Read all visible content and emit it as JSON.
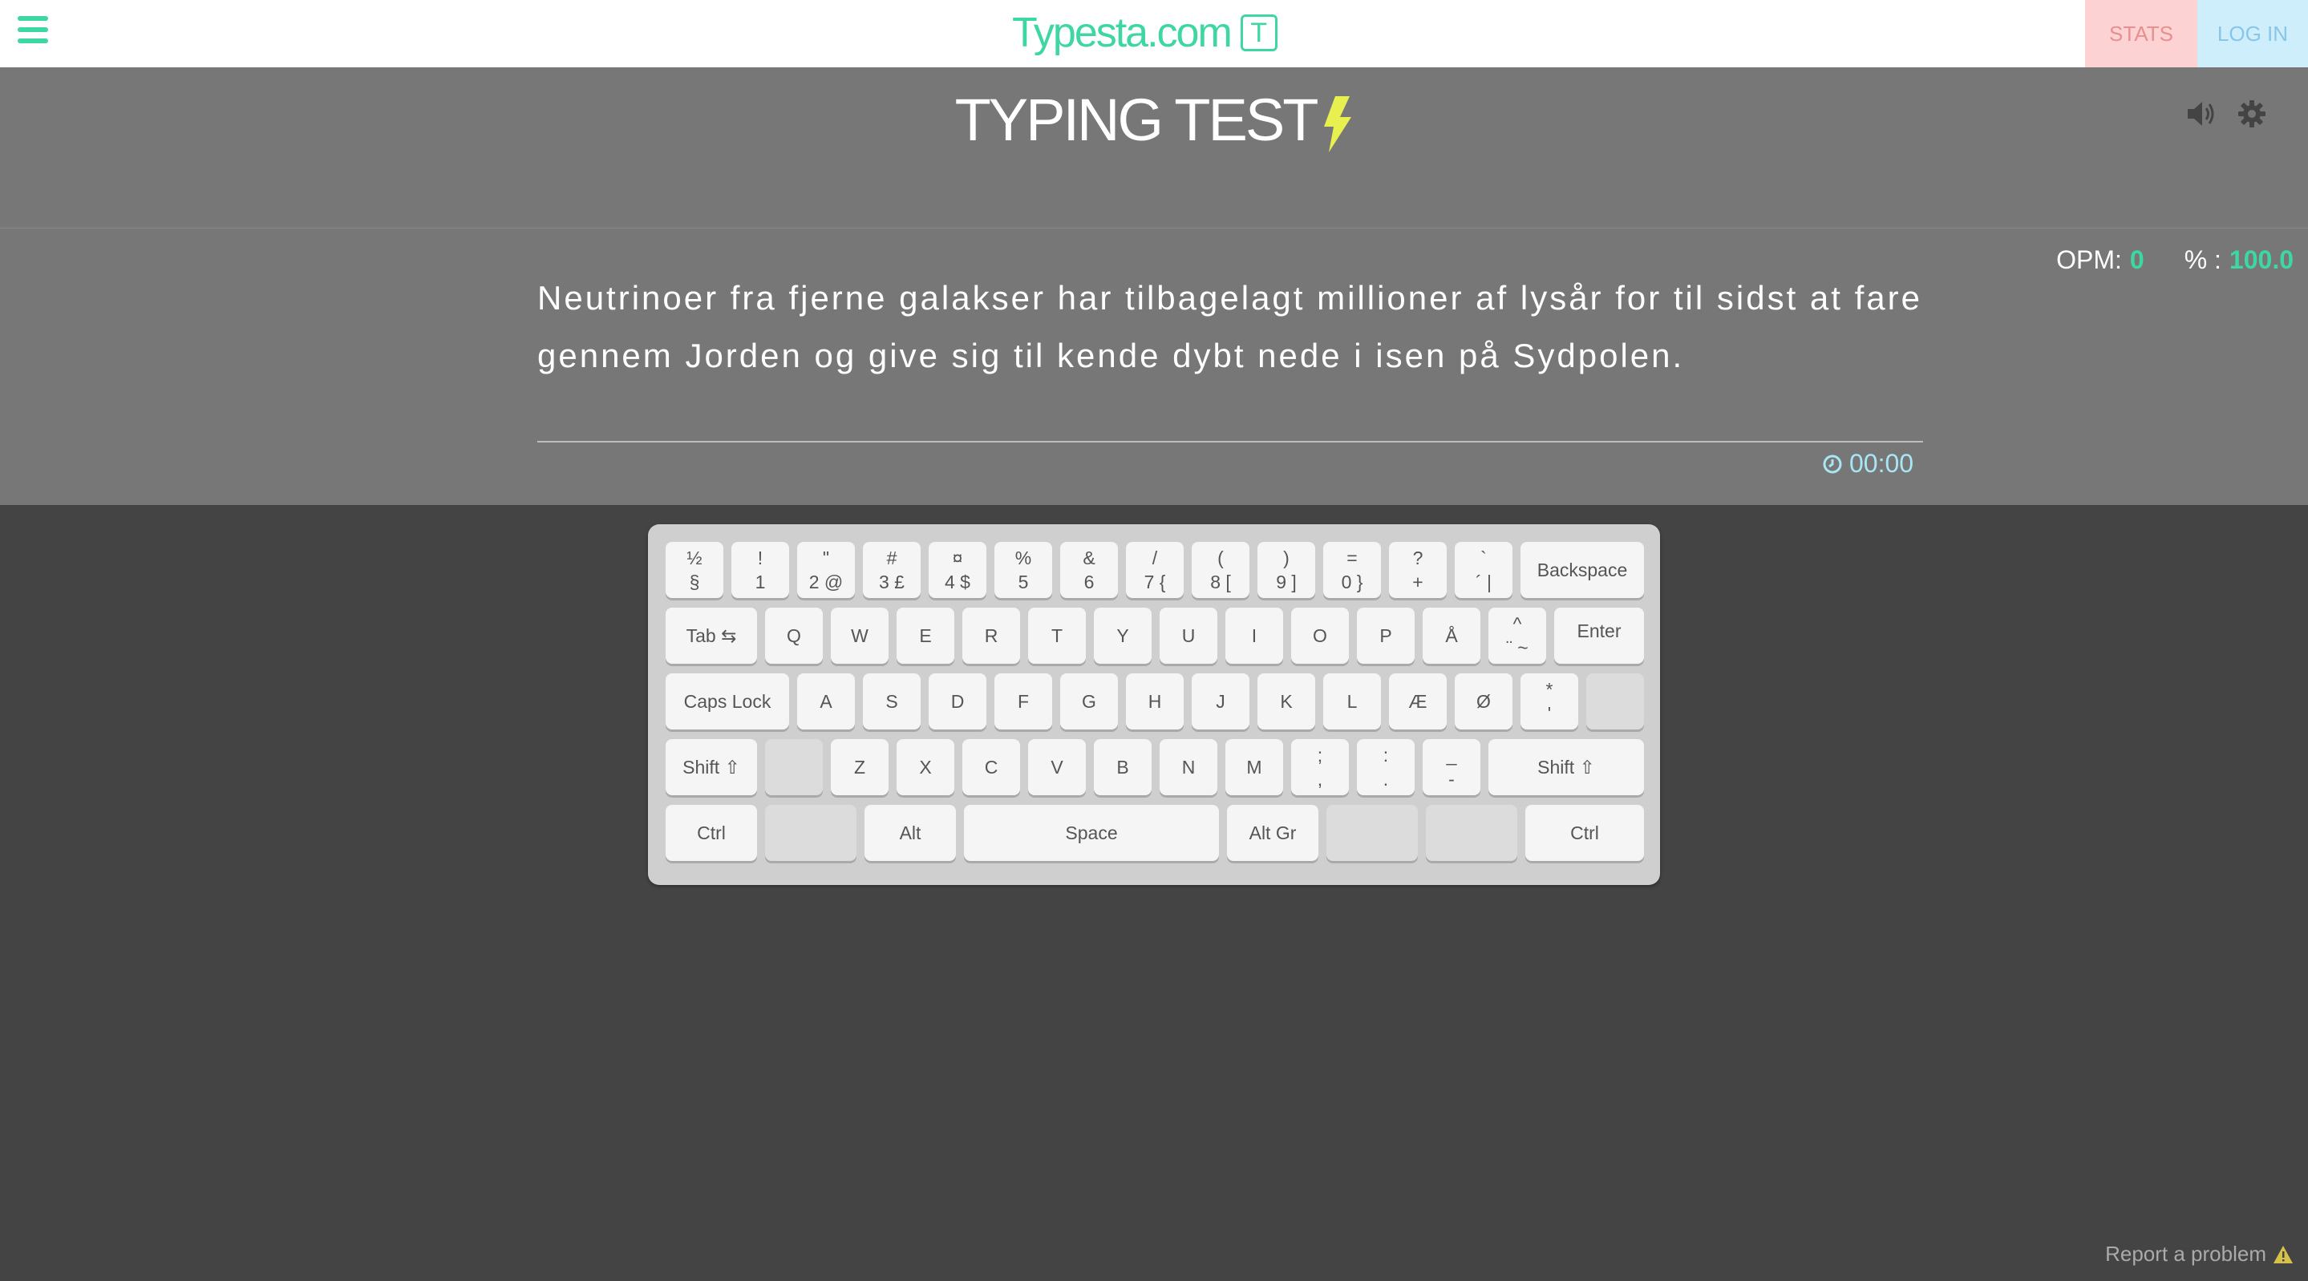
{
  "header": {
    "logo_text": "Typesta.com",
    "logo_mark": "T",
    "stats_label": "STATS",
    "login_label": "LOG IN"
  },
  "test": {
    "title": "TYPING TEST",
    "passage": "Neutrinoer fra fjerne galakser har tilbagelagt millioner af lysår for til sidst at fare gennem Jorden og give sig til kende dybt nede i isen på Sydpolen.",
    "opm_label": "OPM:",
    "opm_value": "0",
    "pct_label": "% :",
    "pct_value": "100.0",
    "timer": "00:00"
  },
  "keyboard": {
    "row1": [
      {
        "t": "½",
        "b": "§"
      },
      {
        "t": "!",
        "b": "1"
      },
      {
        "t": "\"",
        "b": "2 @"
      },
      {
        "t": "#",
        "b": "3 £"
      },
      {
        "t": "¤",
        "b": "4 $"
      },
      {
        "t": "%",
        "b": "5"
      },
      {
        "t": "&",
        "b": "6"
      },
      {
        "t": "/",
        "b": "7 {"
      },
      {
        "t": "(",
        "b": "8 ["
      },
      {
        "t": ")",
        "b": "9 ]"
      },
      {
        "t": "=",
        "b": "0 }"
      },
      {
        "t": "?",
        "b": "+"
      },
      {
        "t": "`",
        "b": "´ |"
      },
      {
        "t": "Backspace",
        "b": ""
      }
    ],
    "row2": [
      "Tab ⇆",
      "Q",
      "W",
      "E",
      "R",
      "T",
      "Y",
      "U",
      "I",
      "O",
      "P",
      "Å",
      "^\n¨ ~",
      "Enter"
    ],
    "row3": [
      "Caps Lock",
      "A",
      "S",
      "D",
      "F",
      "G",
      "H",
      "J",
      "K",
      "L",
      "Æ",
      "Ø",
      "*\n'",
      ""
    ],
    "row4": [
      "Shift ⇧",
      "",
      "Z",
      "X",
      "C",
      "V",
      "B",
      "N",
      "M",
      ";\n,",
      ":\n.",
      "_\n-",
      "Shift ⇧"
    ],
    "row5": [
      "Ctrl",
      "",
      "Alt",
      "Space",
      "Alt Gr",
      "",
      "",
      "Ctrl"
    ]
  },
  "footer": {
    "report": "Report a problem"
  },
  "colors": {
    "accent": "#3ed7a2",
    "stats_bg": "#fcd2d2",
    "login_bg": "#cfeefc",
    "timer": "#a9e6f5"
  }
}
